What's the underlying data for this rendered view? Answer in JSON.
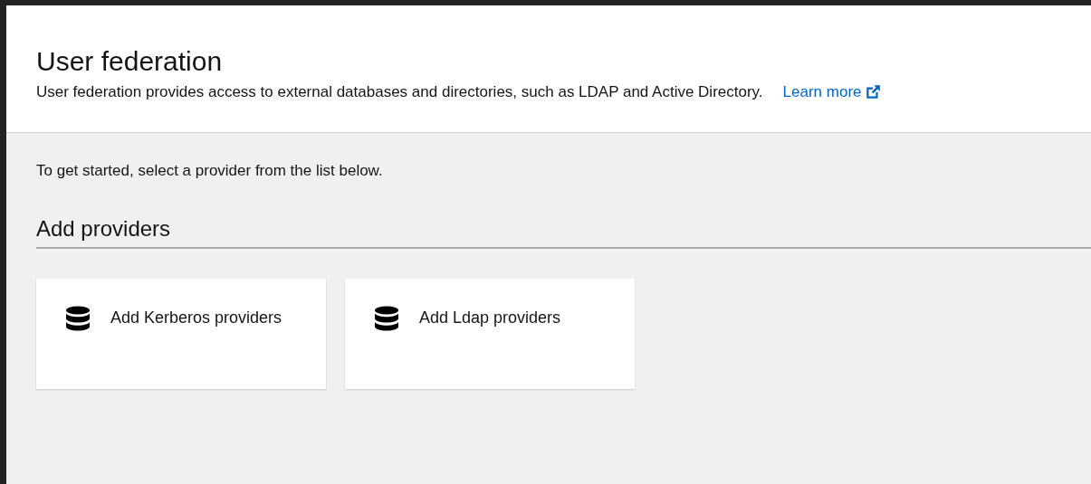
{
  "header": {
    "title": "User federation",
    "description": "User federation provides access to external databases and directories, such as LDAP and Active Directory.",
    "link": "Learn more"
  },
  "intro": "To get started, select a provider from the list below.",
  "section_title": "Add providers",
  "providers": [
    {
      "label": "Add Kerberos providers"
    },
    {
      "label": "Add Ldap providers"
    }
  ]
}
